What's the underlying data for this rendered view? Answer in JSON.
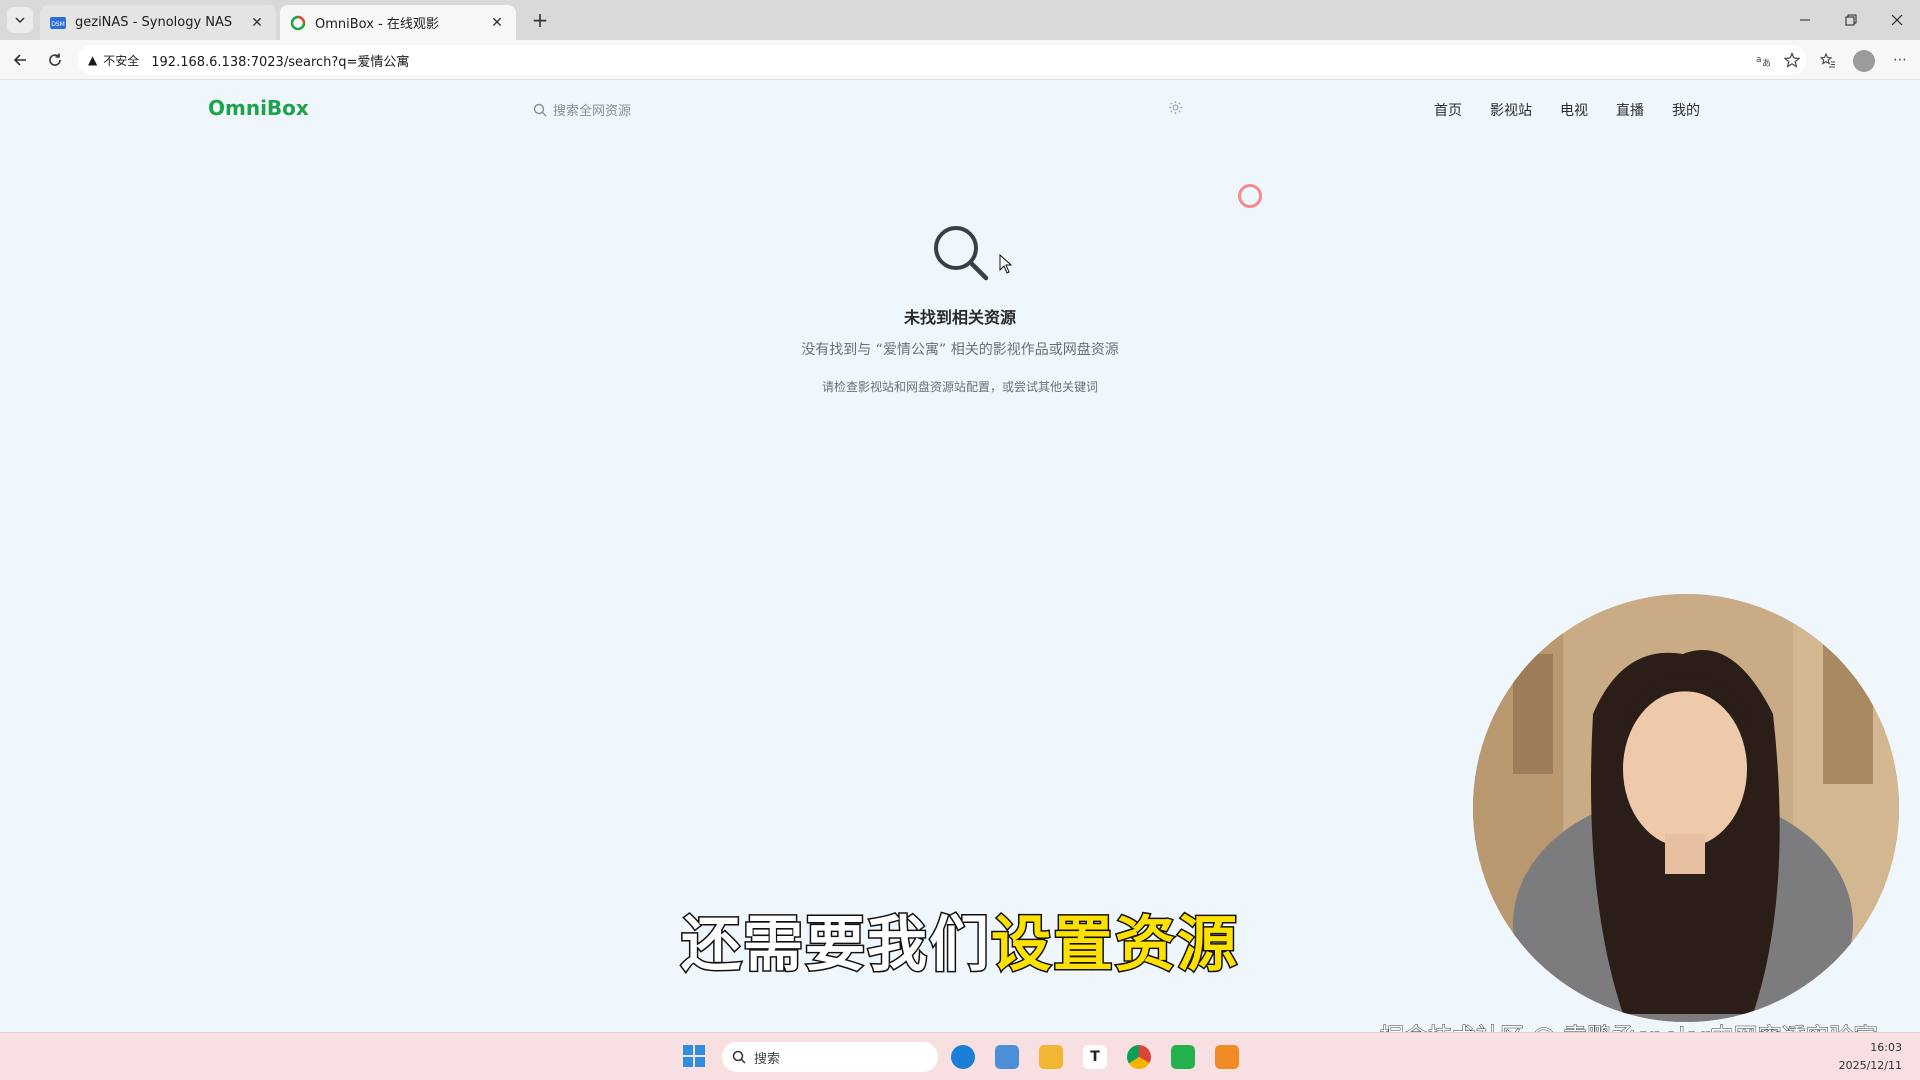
{
  "browser": {
    "tabs": [
      {
        "title": "geziNAS - Synology NAS",
        "active": false
      },
      {
        "title": "OmniBox - 在线观影",
        "active": true
      }
    ],
    "address": {
      "security_label": "不安全",
      "url": "192.168.6.138:7023/search?q=爱情公寓"
    }
  },
  "site": {
    "brand": "OmniBox",
    "search_placeholder": "搜索全网资源",
    "nav": [
      "首页",
      "影视站",
      "电视",
      "直播",
      "我的"
    ]
  },
  "empty_state": {
    "title": "未找到相关资源",
    "description": "没有找到与 “爱情公寓” 相关的影视作品或网盘资源",
    "hint": "请检查影视站和网盘资源站配置，或尝试其他关键词"
  },
  "video_overlay": {
    "subtitle_white": "还需要我们",
    "subtitle_yellow": "设置资源",
    "watermark": "掘金技术社区 @ 袁鹏丞cpolar内网穿透实验室"
  },
  "taskbar": {
    "search_label": "搜索",
    "time": "16:03",
    "date": "2025/12/11"
  },
  "colors": {
    "brand_green": "#1ca34b",
    "page_bg": "#f0f7fc",
    "subtitle_yellow": "#ffe100",
    "taskbar_bg": "#f7dfe2"
  }
}
